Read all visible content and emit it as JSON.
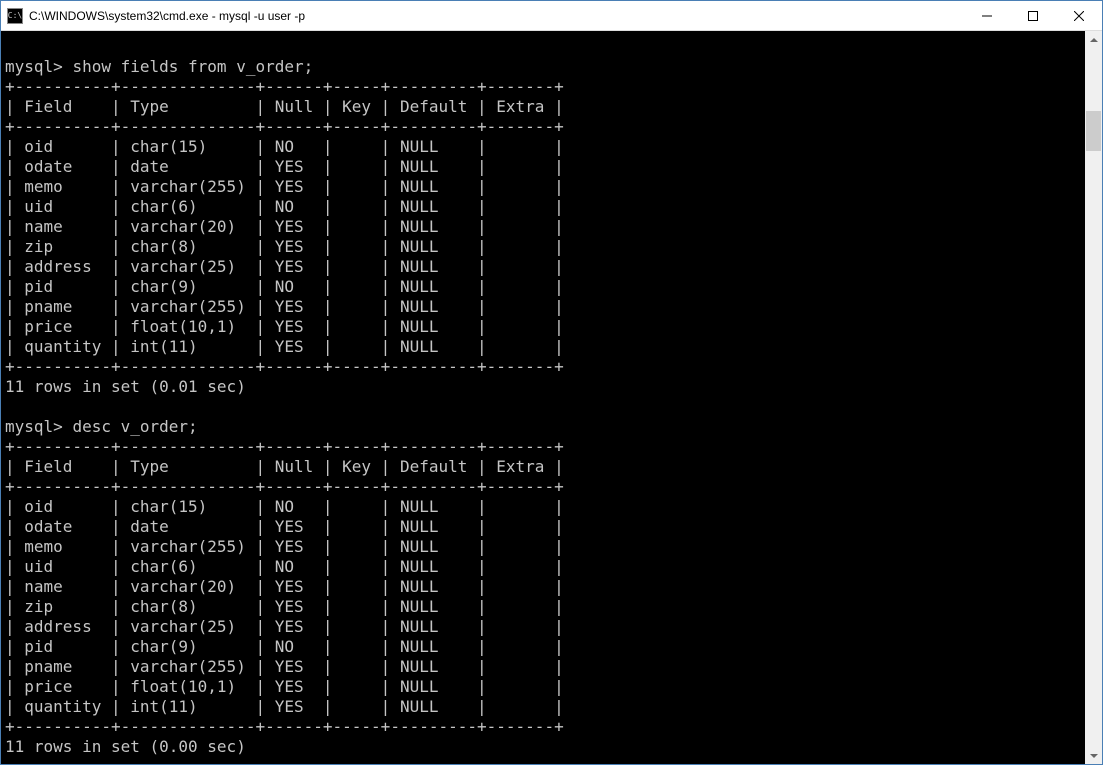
{
  "titlebar": {
    "icon_text": "C:\\",
    "title": "C:\\WINDOWS\\system32\\cmd.exe - mysql  -u user -p"
  },
  "prompts": {
    "p1": "mysql> ",
    "p2": "mysql> "
  },
  "commands": {
    "c1": "show fields from v_order;",
    "c2": "desc v_order;"
  },
  "table_border": {
    "sep": "+----------+--------------+------+-----+---------+-------+",
    "header_row": "| Field    | Type         | Null | Key | Default | Extra |"
  },
  "rows": {
    "r1": "| oid      | char(15)     | NO   |     | NULL    |       |",
    "r2": "| odate    | date         | YES  |     | NULL    |       |",
    "r3": "| memo     | varchar(255) | YES  |     | NULL    |       |",
    "r4": "| uid      | char(6)      | NO   |     | NULL    |       |",
    "r5": "| name     | varchar(20)  | YES  |     | NULL    |       |",
    "r6": "| zip      | char(8)      | YES  |     | NULL    |       |",
    "r7": "| address  | varchar(25)  | YES  |     | NULL    |       |",
    "r8": "| pid      | char(9)      | NO   |     | NULL    |       |",
    "r9": "| pname    | varchar(255) | YES  |     | NULL    |       |",
    "r10": "| price    | float(10,1)  | YES  |     | NULL    |       |",
    "r11": "| quantity | int(11)      | YES  |     | NULL    |       |"
  },
  "footers": {
    "f1": "11 rows in set (0.01 sec)",
    "f2": "11 rows in set (0.00 sec)"
  },
  "blank": ""
}
